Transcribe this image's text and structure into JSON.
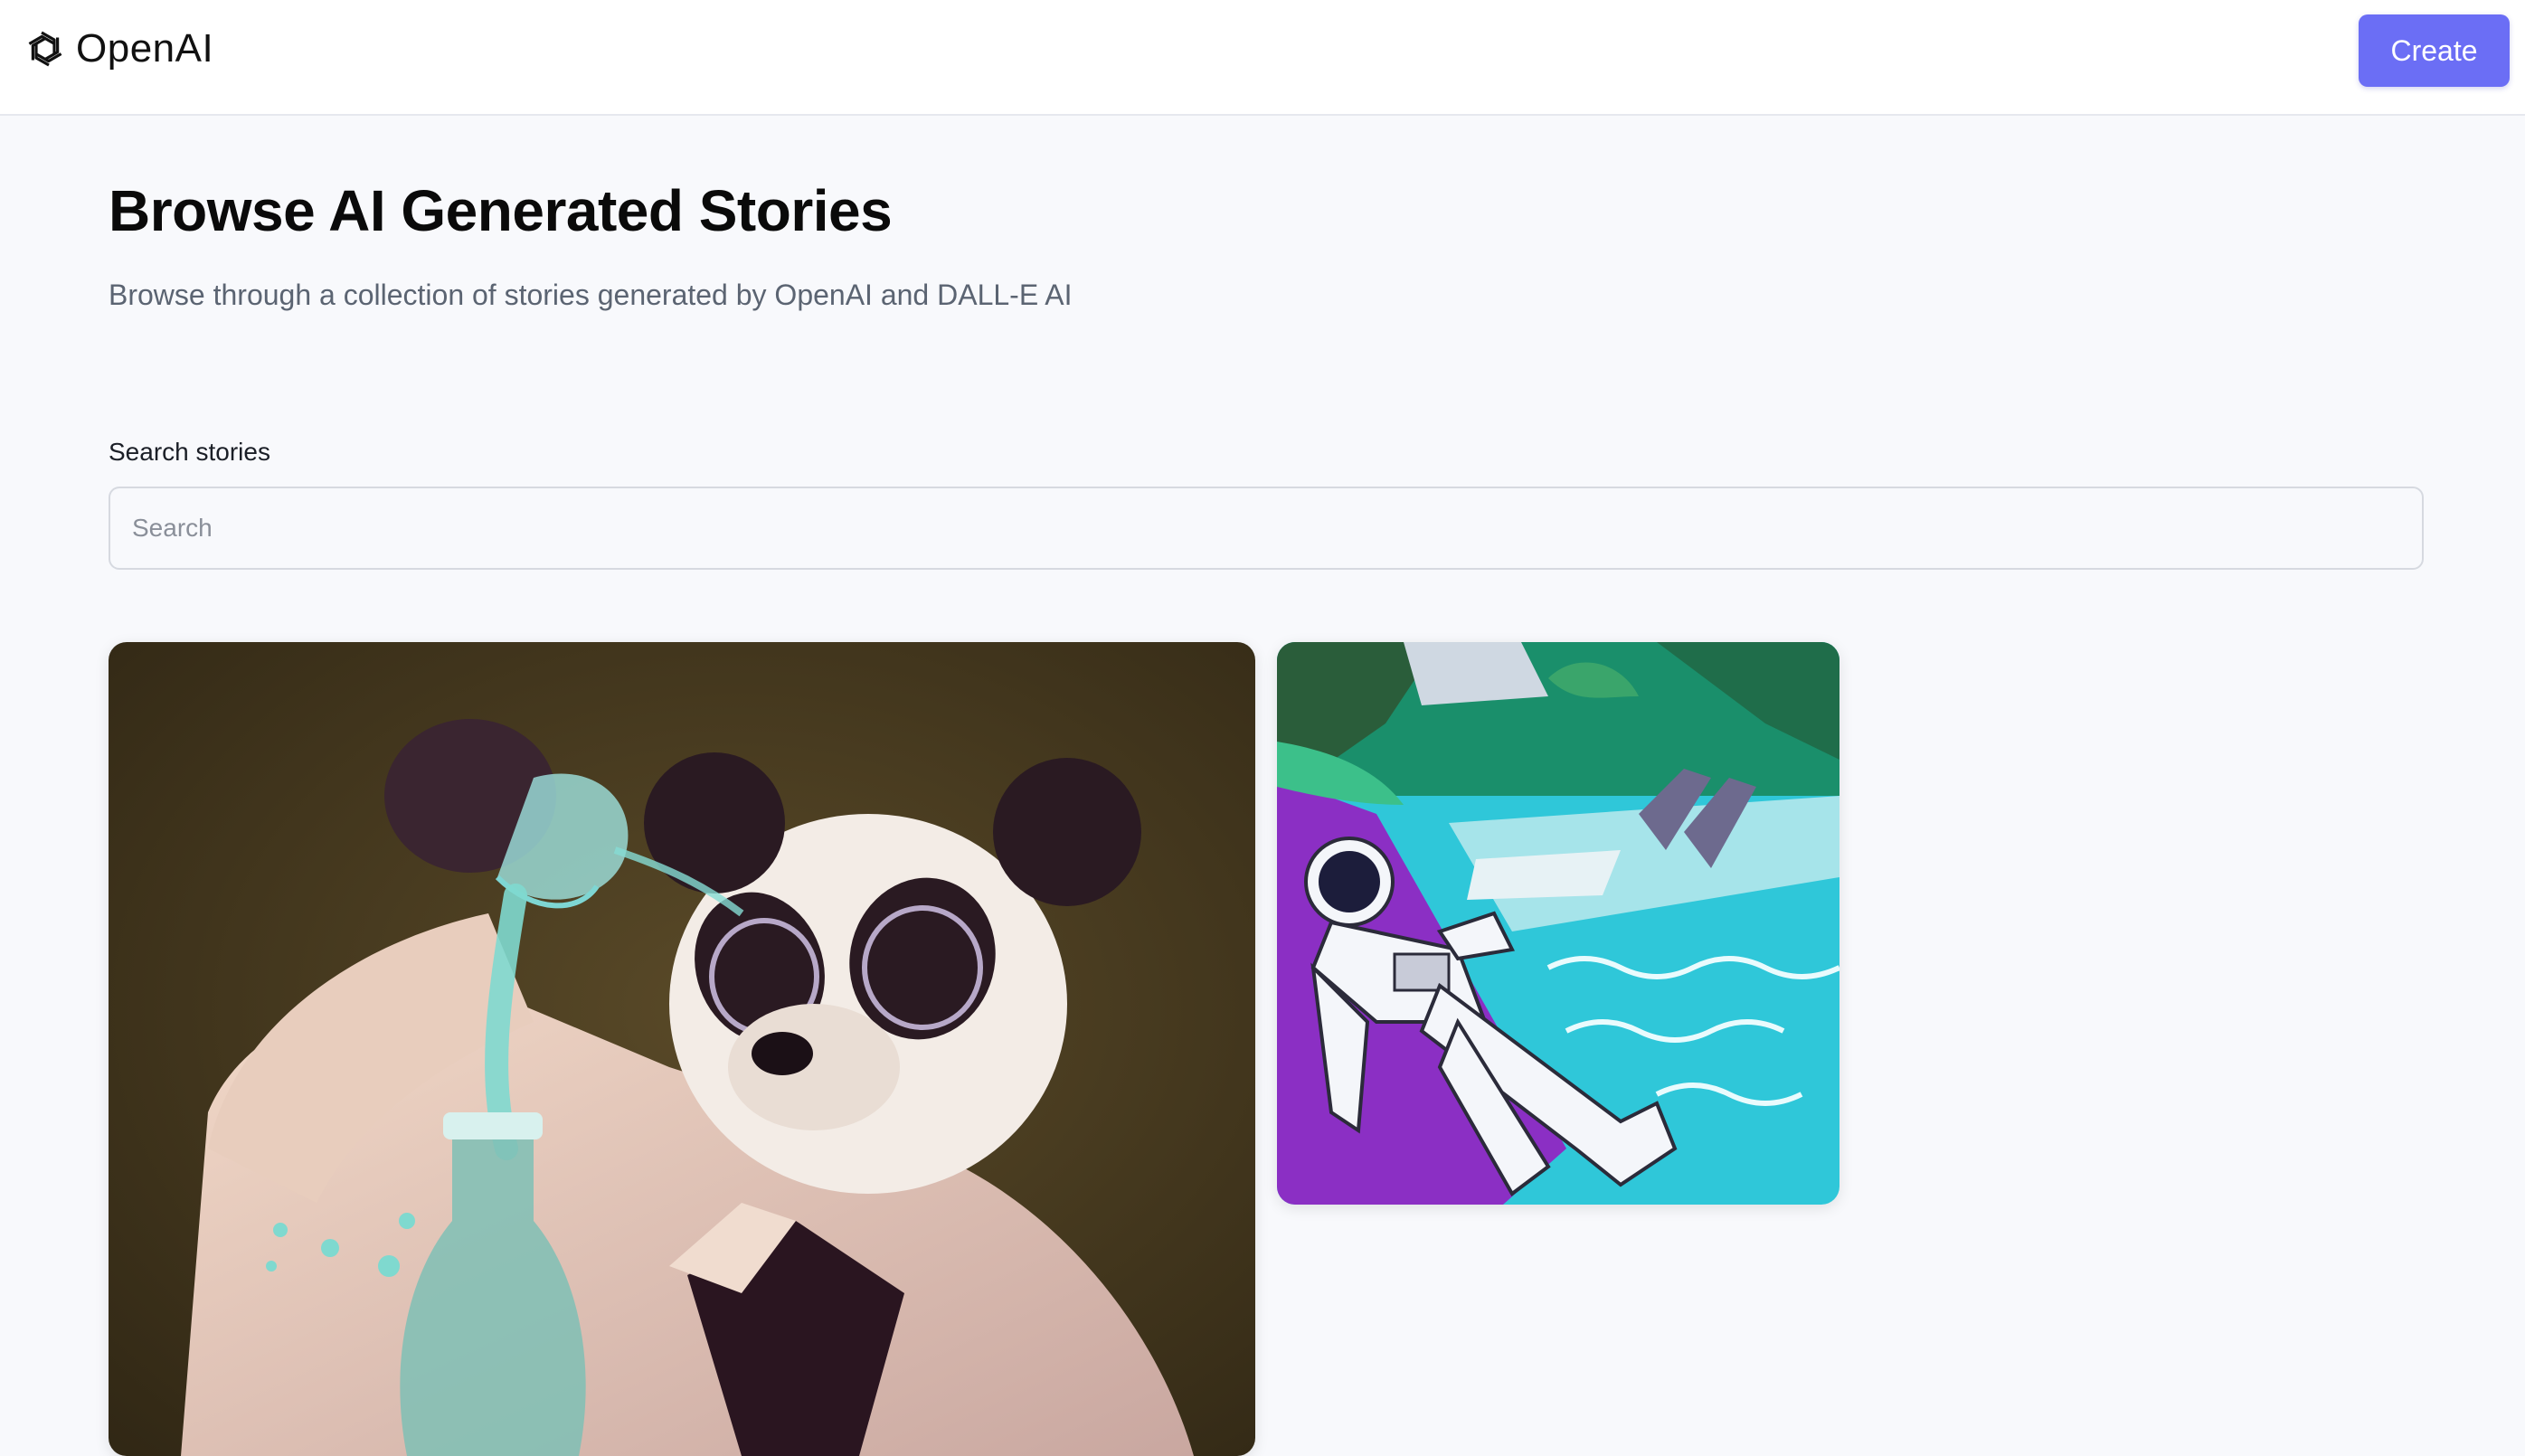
{
  "header": {
    "logo_text": "OpenAI",
    "logo_icon": "openai-logo-icon",
    "create_label": "Create",
    "accent_color": "#6b6ef5"
  },
  "main": {
    "title": "Browse AI Generated Stories",
    "subtitle": "Browse through a collection of stories generated by OpenAI and DALL-E AI",
    "search": {
      "label": "Search stories",
      "placeholder": "Search",
      "value": ""
    },
    "stories": [
      {
        "image": "panda-scientist-pouring-liquid-illustration"
      },
      {
        "image": "astronaut-lounging-by-tropical-pool-illustration"
      }
    ]
  }
}
